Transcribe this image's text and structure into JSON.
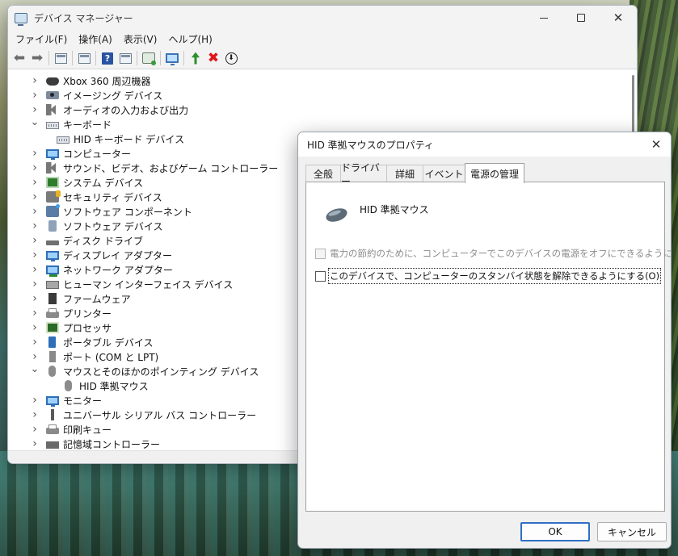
{
  "device_manager": {
    "title": "デバイス マネージャー",
    "menu": [
      "ファイル(F)",
      "操作(A)",
      "表示(V)",
      "ヘルプ(H)"
    ],
    "tree": [
      {
        "label": "Xbox 360 周辺機器",
        "expanded": false,
        "icon": "gamepad-icon"
      },
      {
        "label": "イメージング デバイス",
        "expanded": false,
        "icon": "camera-icon"
      },
      {
        "label": "オーディオの入力および出力",
        "expanded": false,
        "icon": "speaker-icon"
      },
      {
        "label": "キーボード",
        "expanded": true,
        "icon": "keyboard-icon"
      },
      {
        "label": "HID キーボード デバイス",
        "child": true,
        "icon": "keyboard-icon"
      },
      {
        "label": "コンピューター",
        "expanded": false,
        "icon": "monitor-icon"
      },
      {
        "label": "サウンド、ビデオ、およびゲーム コントローラー",
        "expanded": false,
        "icon": "speaker-icon"
      },
      {
        "label": "システム デバイス",
        "expanded": false,
        "icon": "chip-icon"
      },
      {
        "label": "セキュリティ デバイス",
        "expanded": false,
        "icon": "security-icon"
      },
      {
        "label": "ソフトウェア コンポーネント",
        "expanded": false,
        "icon": "puzzle-icon"
      },
      {
        "label": "ソフトウェア デバイス",
        "expanded": false,
        "icon": "box-icon"
      },
      {
        "label": "ディスク ドライブ",
        "expanded": false,
        "icon": "drive-icon"
      },
      {
        "label": "ディスプレイ アダプター",
        "expanded": false,
        "icon": "monitor-icon"
      },
      {
        "label": "ネットワーク アダプター",
        "expanded": false,
        "icon": "network-icon"
      },
      {
        "label": "ヒューマン インターフェイス デバイス",
        "expanded": false,
        "icon": "hid-icon"
      },
      {
        "label": "ファームウェア",
        "expanded": false,
        "icon": "firmware-icon"
      },
      {
        "label": "プリンター",
        "expanded": false,
        "icon": "printer-icon"
      },
      {
        "label": "プロセッサ",
        "expanded": false,
        "icon": "cpu-icon"
      },
      {
        "label": "ポータブル デバイス",
        "expanded": false,
        "icon": "portable-icon"
      },
      {
        "label": "ポート (COM と LPT)",
        "expanded": false,
        "icon": "port-icon"
      },
      {
        "label": "マウスとそのほかのポインティング デバイス",
        "expanded": true,
        "icon": "mouse-icon"
      },
      {
        "label": "HID 準拠マウス",
        "child": true,
        "icon": "mouse-icon"
      },
      {
        "label": "モニター",
        "expanded": false,
        "icon": "monitor-icon"
      },
      {
        "label": "ユニバーサル シリアル バス コントローラー",
        "expanded": false,
        "icon": "usb-icon"
      },
      {
        "label": "印刷キュー",
        "expanded": false,
        "icon": "printer-icon"
      },
      {
        "label": "記憶域コントローラー",
        "expanded": false,
        "icon": "storage-icon"
      }
    ]
  },
  "properties": {
    "title": "HID 準拠マウスのプロパティ",
    "tabs": [
      "全般",
      "ドライバー",
      "詳細",
      "イベント",
      "電源の管理"
    ],
    "active_tab": "電源の管理",
    "device_name": "HID 準拠マウス",
    "option_power_saving": {
      "label": "電力の節約のために、コンピューターでこのデバイスの電源をオフにできるようにする(A)",
      "checked": false,
      "enabled": false
    },
    "option_wake": {
      "label": "このデバイスで、コンピューターのスタンバイ状態を解除できるようにする(O)",
      "checked": false,
      "enabled": true
    },
    "ok_label": "OK",
    "cancel_label": "キャンセル"
  },
  "colors": {
    "accent": "#2e6fc4",
    "delete_red": "#e0161b"
  }
}
